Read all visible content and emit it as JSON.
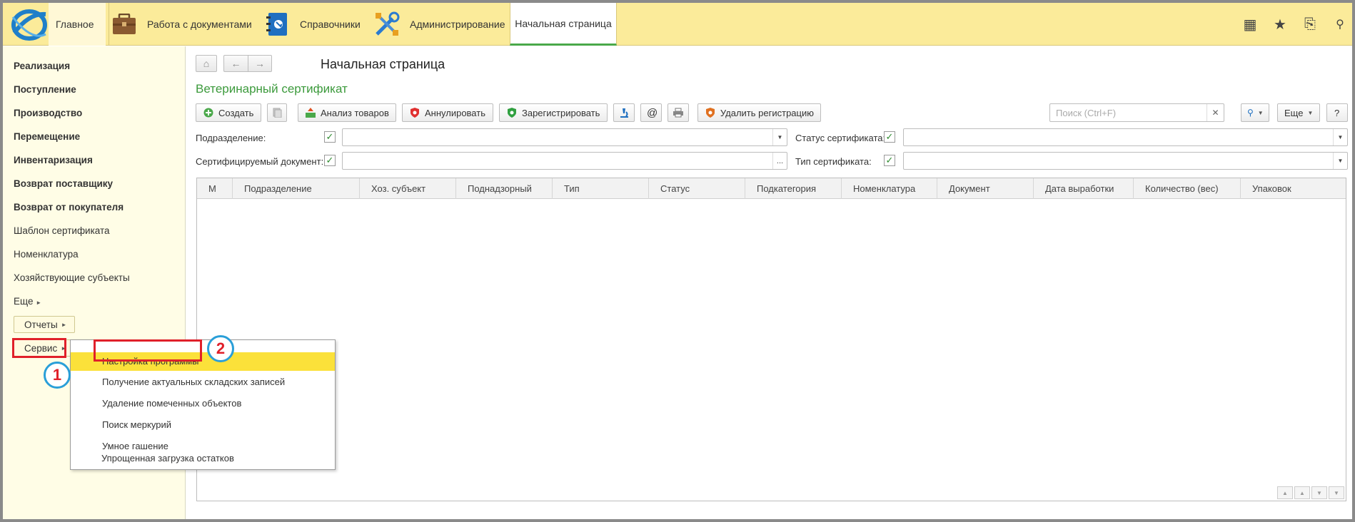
{
  "topbar": {
    "main_label": "Главное",
    "docs_label": "Работа с документами",
    "refs_label": "Справочники",
    "admin_label": "Администрирование",
    "home_tab": "Начальная страница"
  },
  "sidebar": {
    "items": [
      {
        "label": "Реализация"
      },
      {
        "label": "Поступление"
      },
      {
        "label": "Производство"
      },
      {
        "label": "Перемещение"
      },
      {
        "label": "Инвентаризация"
      },
      {
        "label": "Возврат поставщику"
      },
      {
        "label": "Возврат от покупателя"
      },
      {
        "label": "Шаблон сертификата"
      },
      {
        "label": "Номенклатура"
      },
      {
        "label": "Хозяйствующие субъекты"
      },
      {
        "label": "Еще"
      }
    ],
    "reports_label": "Отчеты",
    "service_label": "Сервис"
  },
  "main": {
    "page_title": "Начальная страница",
    "form_title": "Ветеринарный сертификат",
    "toolbar": {
      "create": "Создать",
      "analyze": "Анализ товаров",
      "annul": "Аннулировать",
      "register": "Зарегистрировать",
      "at": "@",
      "unregister": "Удалить регистрацию",
      "search_placeholder": "Поиск (Ctrl+F)",
      "more": "Еще",
      "help": "?"
    },
    "filters": {
      "department": "Подразделение:",
      "cert_doc": "Сертифицируемый документ:",
      "cert_status": "Статус сертификата:",
      "cert_type": "Тип сертификата:",
      "ellipsis": "..."
    },
    "columns": [
      "М",
      "Подразделение",
      "Хоз. субъект",
      "Поднадзорный",
      "Тип",
      "Статус",
      "Подкатегория",
      "Номенклатура",
      "Документ",
      "Дата выработки",
      "Количество (вес)",
      "Упаковок"
    ]
  },
  "popup": {
    "items": [
      "Настройка программы",
      "Получение актуальных складских записей",
      "Удаление помеченных объектов",
      "Поиск меркурий",
      "Умное гашение",
      "Упрощенная загрузка остатков"
    ]
  },
  "annotations": {
    "step1": "1",
    "step2": "2"
  },
  "colors": {
    "topbar": "#fbeb9a",
    "sidebar": "#fffde6",
    "accent_green": "#3c9a3c",
    "highlight_red": "#e0202a",
    "badge_blue": "#2a9fd8",
    "menu_active": "#fbe13a"
  }
}
